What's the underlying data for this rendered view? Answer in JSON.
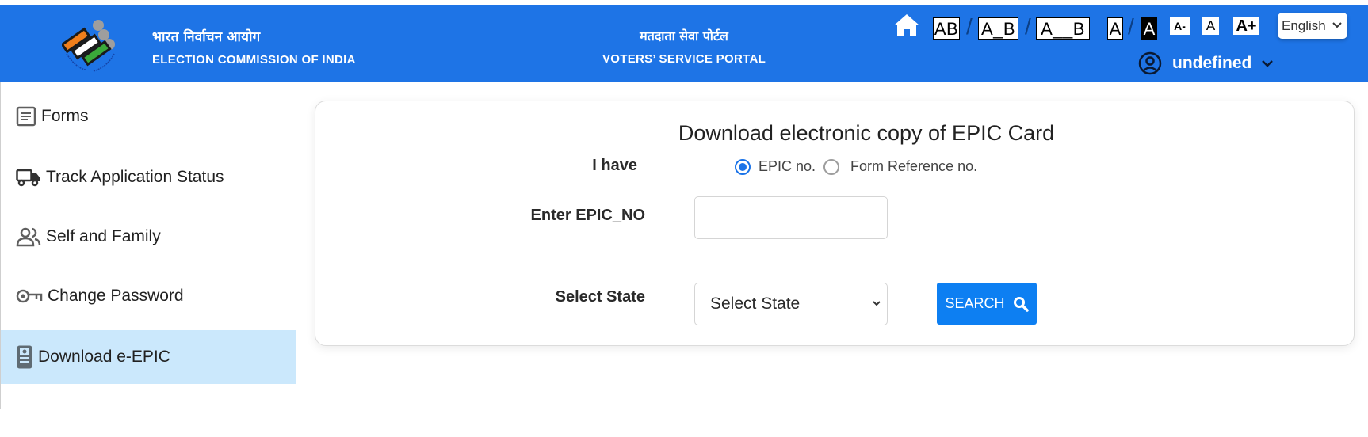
{
  "header": {
    "org_name_hindi": "भारत निर्वाचन आयोग",
    "org_name_english": "ELECTION COMMISSION OF INDIA",
    "portal_name_hindi": "मतदाता सेवा पोर्टल",
    "portal_name_english": "VOTERS’ SERVICE PORTAL",
    "accessibility": {
      "spacing_options": [
        "AB",
        "A_B",
        "A__B"
      ],
      "contrast_options": [
        "A",
        "A"
      ],
      "font_size_options": [
        "A-",
        "A",
        "A+"
      ],
      "separator": "/"
    },
    "language": {
      "selected": "English"
    },
    "user": {
      "name": "undefined"
    }
  },
  "sidebar": {
    "items": [
      {
        "label": "Forms",
        "icon": "document-list-icon",
        "active": false
      },
      {
        "label": "Track Application Status",
        "icon": "truck-icon",
        "active": false
      },
      {
        "label": "Self and Family",
        "icon": "people-icon",
        "active": false
      },
      {
        "label": "Change Password",
        "icon": "key-icon",
        "active": false
      },
      {
        "label": "Download e-EPIC",
        "icon": "id-card-icon",
        "active": true
      }
    ]
  },
  "main": {
    "title": "Download electronic copy of EPIC Card",
    "i_have_label": "I have",
    "radio_options": [
      {
        "label": "EPIC no.",
        "checked": true
      },
      {
        "label": "Form Reference no.",
        "checked": false
      }
    ],
    "epic_label": "Enter EPIC_NO",
    "epic_value": "",
    "state_label": "Select State",
    "state_selected": "Select State",
    "search_label": "SEARCH"
  },
  "colors": {
    "header_bg": "#1e74e6",
    "active_sidebar_bg": "#cbe8fc",
    "primary_button": "#0d7ff2",
    "radio_accent": "#1a73e8"
  }
}
